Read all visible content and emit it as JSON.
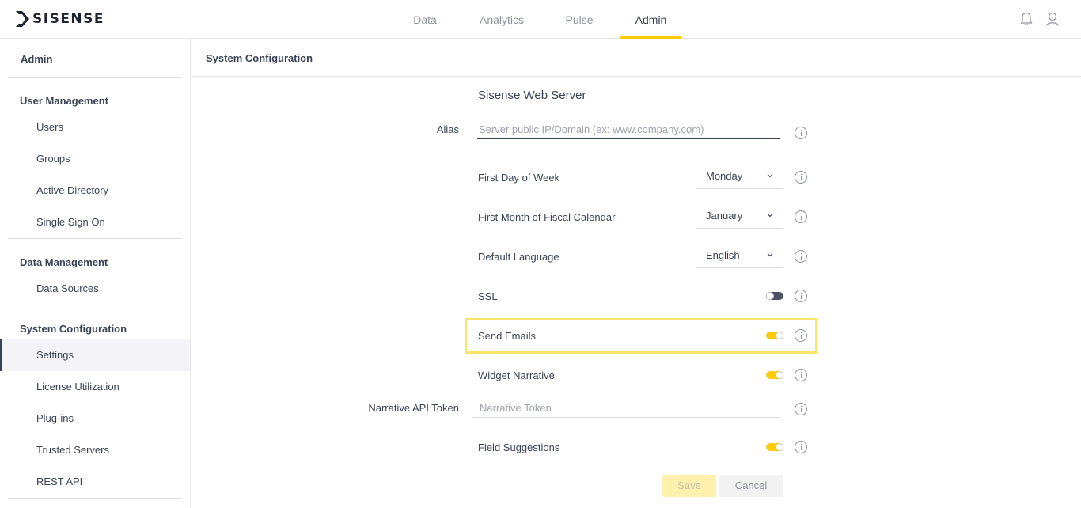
{
  "brand": {
    "name": "SISENSE",
    "accent": "#ffcb05"
  },
  "nav": {
    "tabs": [
      {
        "label": "Data"
      },
      {
        "label": "Analytics"
      },
      {
        "label": "Pulse"
      },
      {
        "label": "Admin",
        "active": true
      }
    ]
  },
  "top_icons": {
    "notifications": "bell-icon",
    "user": "user-icon"
  },
  "sidebar": {
    "title": "Admin",
    "sections": [
      {
        "label": "User Management",
        "items": [
          "Users",
          "Groups",
          "Active Directory",
          "Single Sign On"
        ]
      },
      {
        "label": "Data Management",
        "items": [
          "Data Sources"
        ]
      },
      {
        "label": "System Configuration",
        "items": [
          "Settings",
          "License Utilization",
          "Plug-ins",
          "Trusted Servers",
          "REST API"
        ]
      }
    ],
    "active_item": "Settings"
  },
  "main": {
    "title": "System Configuration",
    "section_title": "Sisense Web Server",
    "alias": {
      "label": "Alias",
      "placeholder": "Server public IP/Domain (ex: www.company.com)",
      "value": ""
    },
    "first_day": {
      "label": "First Day of Week",
      "value": "Monday"
    },
    "first_month": {
      "label": "First Month of Fiscal Calendar",
      "value": "January"
    },
    "language": {
      "label": "Default Language",
      "value": "English"
    },
    "ssl": {
      "label": "SSL",
      "enabled": false
    },
    "send_emails": {
      "label": "Send Emails",
      "enabled": true
    },
    "widget_narrative": {
      "label": "Widget Narrative",
      "enabled": true
    },
    "narrative_token": {
      "label": "Narrative API Token",
      "placeholder": "Narrative Token",
      "value": ""
    },
    "field_suggestions": {
      "label": "Field Suggestions",
      "enabled": true
    },
    "save_label": "Save",
    "cancel_label": "Cancel"
  }
}
